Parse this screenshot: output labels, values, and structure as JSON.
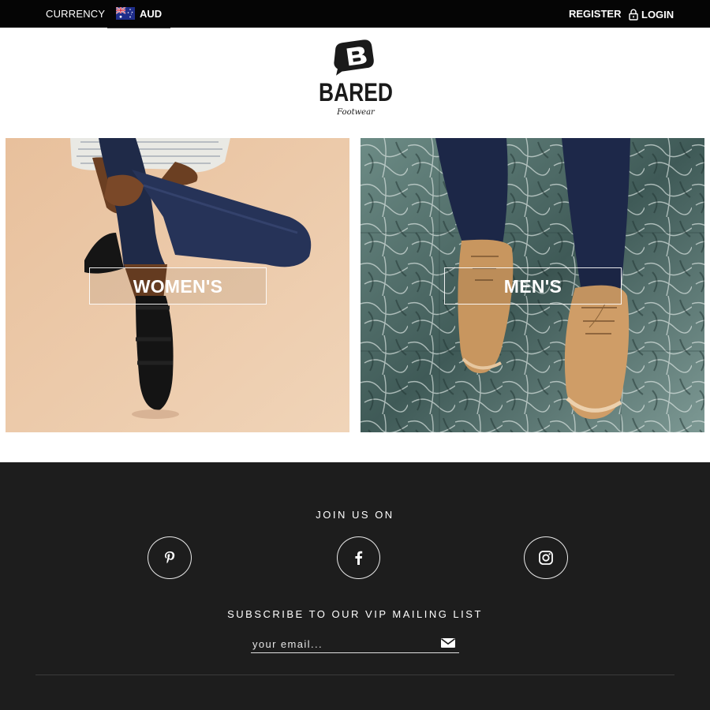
{
  "topbar": {
    "currency_label": "CURRENCY",
    "currency_code": "AUD",
    "register_label": "REGISTER",
    "login_label": "LOGIN"
  },
  "brand": {
    "name": "BARED",
    "tagline": "Footwear"
  },
  "categories": [
    {
      "label": "WOMEN'S"
    },
    {
      "label": "MEN'S"
    }
  ],
  "footer": {
    "join_title": "JOIN US ON",
    "subscribe_title": "SUBSCRIBE TO OUR VIP MAILING LIST",
    "email_placeholder": "your email..."
  },
  "icons": {
    "flag": "australia-flag-icon",
    "lock": "lock-icon",
    "pinterest": "pinterest-icon",
    "facebook": "facebook-icon",
    "instagram": "instagram-icon",
    "send": "envelope-icon"
  },
  "colors": {
    "topbar": "#050505",
    "footer": "#1d1d1d",
    "women_bg": "#e9c3a2",
    "men_bg": "#5e7d78"
  }
}
